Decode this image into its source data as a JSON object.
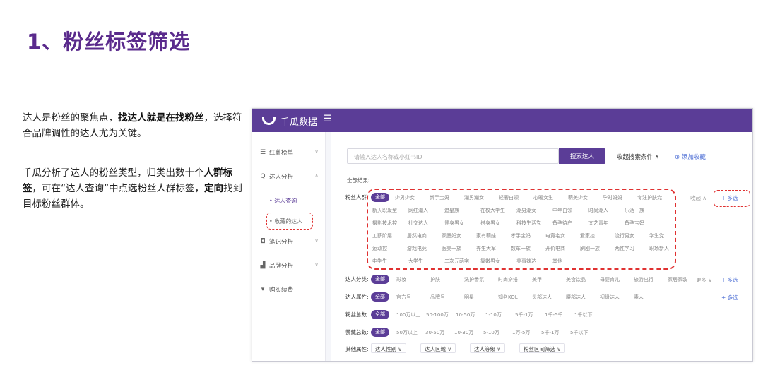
{
  "slide": {
    "title": "1、粉丝标签筛选",
    "p1_a": "达人是粉丝的聚焦点，",
    "p1_b": "找达人就是在找粉丝",
    "p1_c": "，选择符合品牌调性的达人尤为关键。",
    "p2_a": "千瓜分析了达人的粉丝类型，归类出数十个",
    "p2_b": "人群标签",
    "p2_c": "，可在“达人查询”中点选粉丝人群标签，",
    "p2_d": "定向",
    "p2_e": "找到目标粉丝群体。"
  },
  "app": {
    "logo_text": "千瓜数据",
    "menu_icon": "menu-icon",
    "sidebar": {
      "items": [
        {
          "label": "红薯榜单",
          "icon": "list-icon"
        },
        {
          "label": "达人分析",
          "icon": "search-icon"
        },
        {
          "label": "笔记分析",
          "icon": "note-icon"
        },
        {
          "label": "品牌分析",
          "icon": "chart-icon"
        },
        {
          "label": "购买续费",
          "icon": "cart-icon"
        }
      ],
      "sub_items": [
        "达人查询",
        "收藏的达人"
      ]
    },
    "search": {
      "placeholder": "请输入达人名称或小红书ID",
      "button": "搜索达人",
      "collapse": "收起搜索条件 ∧",
      "add_fav": "⊕ 添加收藏"
    },
    "all_results": "全部结果:",
    "filters": {
      "all": "全部",
      "fans_label": "粉丝人群:",
      "fans_tags": [
        [
          "少男少女",
          "新手宝妈",
          "潮男潮女",
          "轻奢白领",
          "心暖女生",
          "萌美少女",
          "孕时妈妈",
          "专注护肤党"
        ],
        [
          "新天职发型",
          "网红潮人",
          "追星族",
          "在校大学生",
          "潮男潮女",
          "中年白领",
          "时尚潮人",
          "乐活一族"
        ],
        [
          "摄影技术控",
          "社交达人",
          "健身男女",
          "搭身男女",
          "科技生活党",
          "备孕待产",
          "文艺青年",
          "备孕宝妈"
        ],
        [
          "工薪阶层",
          "居然电商",
          "家庭妇女",
          "家有萌娃",
          "孝手宝妈",
          "电竞宅女",
          "爱家控",
          "流行男女",
          "学生党"
        ],
        [
          "运动控",
          "游戏电竞",
          "医美一族",
          "养生大军",
          "数车一族",
          "开价电商",
          "刷剧一族",
          "两性学习",
          "职场新人"
        ],
        [
          "中学生",
          "大学生",
          "二次元萌宅",
          "靠嫩男女",
          "美事辣达",
          "其他"
        ]
      ],
      "fans_more": "收起 ∧",
      "multi": "+ 多选",
      "category_label": "达人分类:",
      "category_tags": [
        "彩妆",
        "护肤",
        "洗护香氛",
        "时尚穿搭",
        "美甲",
        "美食饮品",
        "母婴育儿",
        "旅游出行",
        "家居家装"
      ],
      "category_more": "更多 ∨",
      "attr_label": "达人属性:",
      "attr_tags": [
        "官方号",
        "品牌号",
        "明星",
        "知名KOL",
        "头部达人",
        "腰部达人",
        "初级达人",
        "素人"
      ],
      "fans_total_label": "粉丝总数:",
      "fans_total_tags": [
        "100万以上",
        "50-100万",
        "10-50万",
        "1-10万",
        "5千-1万",
        "1千-5千",
        "1千以下"
      ],
      "likes_label": "赞藏总数:",
      "likes_tags": [
        "50万以上",
        "30-50万",
        "10-30万",
        "5-10万",
        "1万-5万",
        "5千-1万",
        "5千以下"
      ],
      "other_label": "其他属性:",
      "other_selects": [
        "达人性别 ∨",
        "达人区域 ∨",
        "达人等级 ∨",
        "粉丝区间筛选 ∨"
      ]
    },
    "colors": {
      "brand": "#5b3d97",
      "highlight": "#e03131",
      "link": "#4a6cd4"
    }
  }
}
